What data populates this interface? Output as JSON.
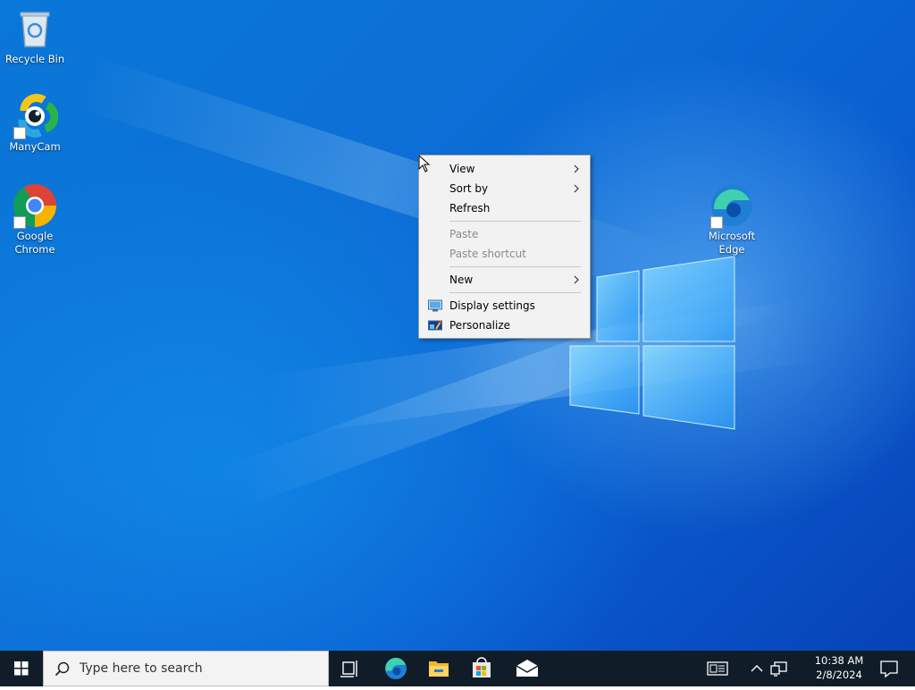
{
  "desktop": {
    "icons": [
      {
        "label": "Recycle Bin"
      },
      {
        "label": "ManyCam"
      },
      {
        "label": "Google Chrome"
      },
      {
        "label": "Microsoft Edge"
      }
    ]
  },
  "context_menu": {
    "items": [
      {
        "label": "View",
        "submenu": true,
        "enabled": true
      },
      {
        "label": "Sort by",
        "submenu": true,
        "enabled": true
      },
      {
        "label": "Refresh",
        "submenu": false,
        "enabled": true
      },
      {
        "label": "Paste",
        "submenu": false,
        "enabled": false
      },
      {
        "label": "Paste shortcut",
        "submenu": false,
        "enabled": false
      },
      {
        "label": "New",
        "submenu": true,
        "enabled": true
      },
      {
        "label": "Display settings",
        "icon": "display-icon",
        "enabled": true
      },
      {
        "label": "Personalize",
        "icon": "personalize-icon",
        "enabled": true
      }
    ]
  },
  "taskbar": {
    "search_placeholder": "Type here to search",
    "pinned": [
      "task-view-icon",
      "edge-icon",
      "file-explorer-icon",
      "store-icon",
      "mail-icon"
    ],
    "tray": [
      "news-icon",
      "chevron-up-icon",
      "network-icon"
    ],
    "time": "10:38 AM",
    "date": "2/8/2024",
    "notifications_icon": "notification-icon"
  },
  "colors": {
    "taskbar": "#101c28",
    "menu_bg": "#f2f2f2",
    "disabled_text": "#8a8a8a"
  }
}
